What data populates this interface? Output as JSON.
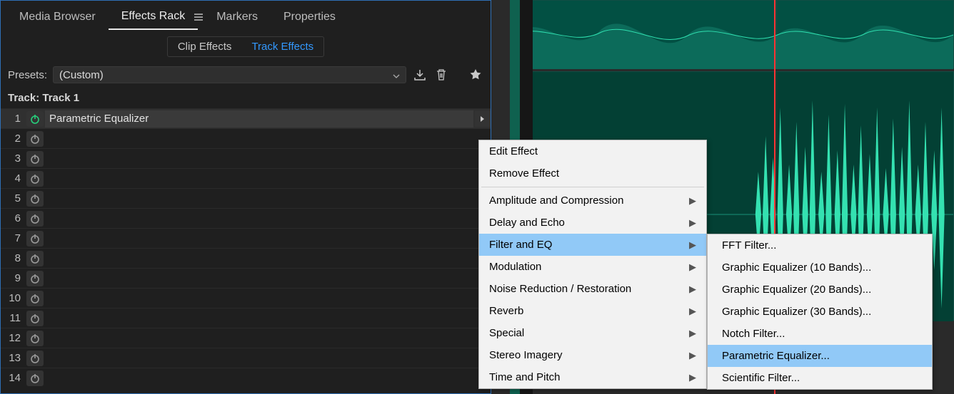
{
  "tabs": {
    "media": "Media Browser",
    "effects": "Effects Rack",
    "markers": "Markers",
    "properties": "Properties"
  },
  "subtabs": {
    "clip": "Clip Effects",
    "track": "Track Effects"
  },
  "presets_label": "Presets:",
  "preset_value": "(Custom)",
  "track_label": "Track: Track 1",
  "slot_effect": "Parametric Equalizer",
  "slot_nums": [
    "1",
    "2",
    "3",
    "4",
    "5",
    "6",
    "7",
    "8",
    "9",
    "10",
    "11",
    "12",
    "13",
    "14"
  ],
  "ctx": {
    "edit": "Edit Effect",
    "remove": "Remove Effect",
    "amp": "Amplitude and Compression",
    "delay": "Delay and Echo",
    "filter": "Filter and EQ",
    "mod": "Modulation",
    "noise": "Noise Reduction / Restoration",
    "reverb": "Reverb",
    "special": "Special",
    "stereo": "Stereo Imagery",
    "time": "Time and Pitch"
  },
  "sub": {
    "fft": "FFT Filter...",
    "g10": "Graphic Equalizer (10 Bands)...",
    "g20": "Graphic Equalizer (20 Bands)...",
    "g30": "Graphic Equalizer (30 Bands)...",
    "notch": "Notch Filter...",
    "param": "Parametric Equalizer...",
    "sci": "Scientific Filter..."
  }
}
